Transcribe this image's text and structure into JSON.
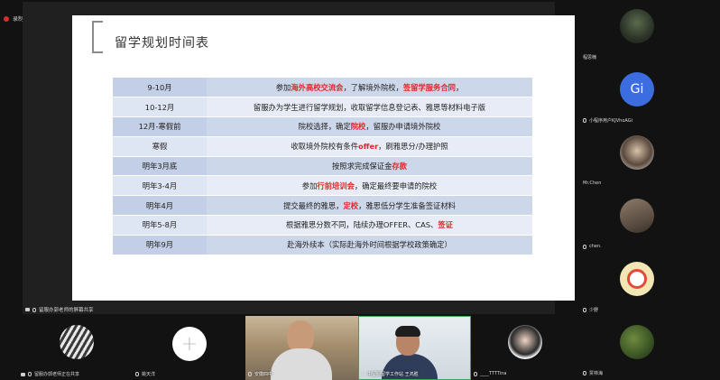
{
  "recording": {
    "label": "录制中"
  },
  "slide": {
    "title": "留学规划时间表",
    "rows": [
      {
        "time": "9-10月",
        "parts": [
          {
            "t": "参加"
          },
          {
            "t": "海外高校交流会",
            "hl": true
          },
          {
            "t": "，了解境外院校，"
          },
          {
            "t": "签留学服务合同",
            "hl": true
          },
          {
            "t": "，"
          }
        ]
      },
      {
        "time": "10-12月",
        "parts": [
          {
            "t": "留服办为学生进行留学规划，收取留学信息登记表、雅思等材料电子版"
          }
        ]
      },
      {
        "time": "12月-寒假前",
        "parts": [
          {
            "t": "院校选择，确定"
          },
          {
            "t": "院校",
            "hl": true
          },
          {
            "t": "，留服办申请境外院校"
          }
        ]
      },
      {
        "time": "寒假",
        "parts": [
          {
            "t": "收取境外院校有条件"
          },
          {
            "t": "offer",
            "hl": true
          },
          {
            "t": "，刷雅思分/办理护照"
          }
        ]
      },
      {
        "time": "明年3月底",
        "parts": [
          {
            "t": "按照求完成保证金"
          },
          {
            "t": "存款",
            "hl": true
          }
        ]
      },
      {
        "time": "明年3-4月",
        "parts": [
          {
            "t": "参加"
          },
          {
            "t": "行前培训会",
            "hl": true
          },
          {
            "t": "，确定最终要申请的院校"
          }
        ]
      },
      {
        "time": "明年4月",
        "parts": [
          {
            "t": "提交最终的雅思，"
          },
          {
            "t": "定校",
            "hl": true
          },
          {
            "t": "，雅思低分学生准备签证材料"
          }
        ]
      },
      {
        "time": "明年5-8月",
        "parts": [
          {
            "t": "根据雅思分数不同，陆续办理OFFER、CAS、"
          },
          {
            "t": "签证",
            "hl": true
          }
        ]
      },
      {
        "time": "明年9月",
        "parts": [
          {
            "t": "赴海外续本（实际赴海外时间根据学校政策确定）"
          }
        ]
      }
    ]
  },
  "share_label": "留服办郭老师的屏幕共享",
  "right_participants": [
    {
      "name": "程思楠",
      "avatar": "dark"
    },
    {
      "name": "小程序用户KJVhoAGi",
      "avatar": "initials",
      "initials": "Gi"
    },
    {
      "name": "Mr.Chen",
      "avatar": "man"
    },
    {
      "name": "chen.",
      "avatar": "door"
    },
    {
      "name": "少野",
      "avatar": "logo"
    },
    {
      "name": "贾林海",
      "avatar": "tree"
    }
  ],
  "bottom_participants": [
    {
      "name": "留服办郭老师正在共享",
      "avatar": "zebra"
    },
    {
      "name": "姚天洋",
      "avatar": "plus",
      "plus_glyph": "+"
    },
    {
      "name": "安徽四中",
      "avatar": "video1"
    },
    {
      "name": "中留服留学工作站 王鸿胜",
      "avatar": "video2"
    },
    {
      "name": "____TTTTina",
      "avatar": "girl"
    }
  ]
}
